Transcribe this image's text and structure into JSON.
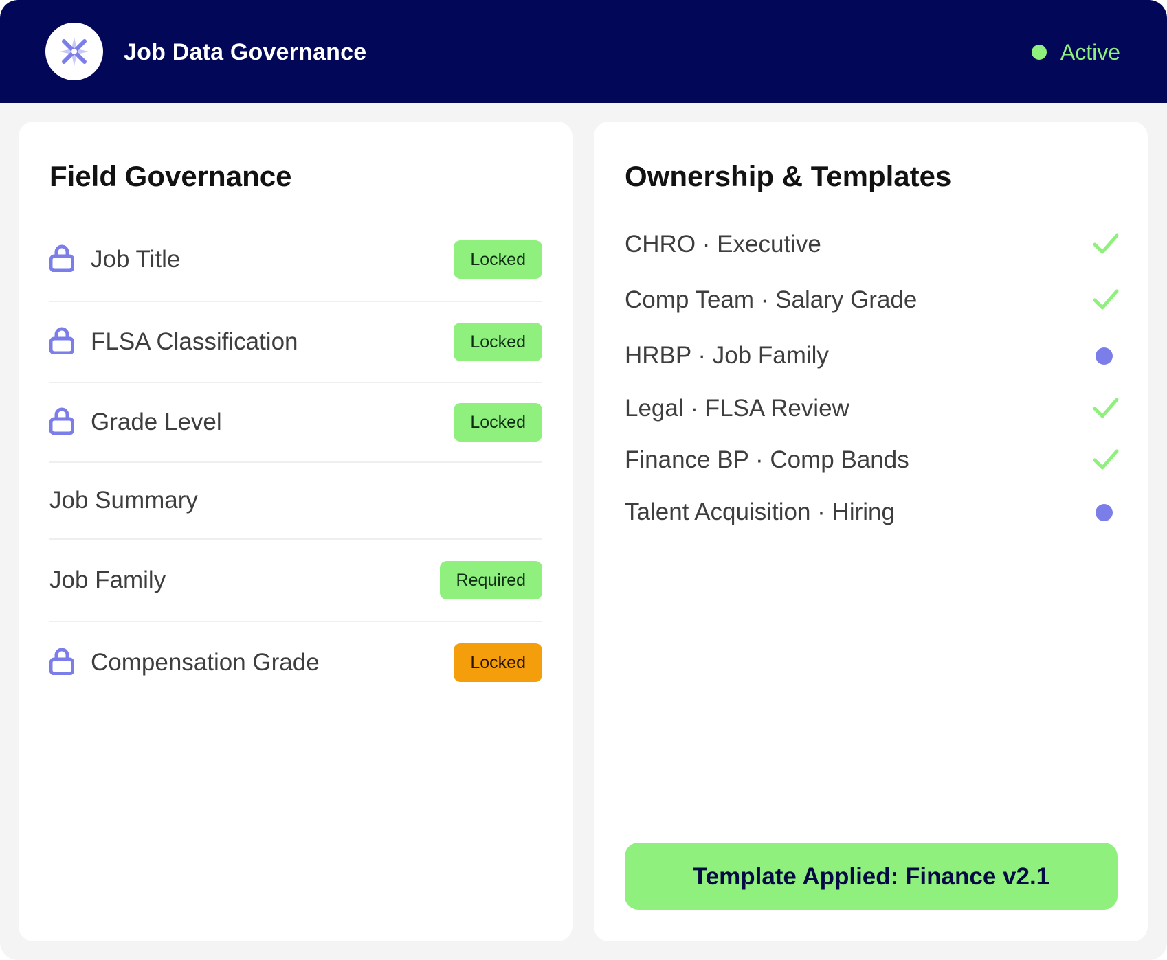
{
  "header": {
    "logo_icon": "star-x-logo-icon",
    "title": "Job Data Governance",
    "status_label": "Active",
    "status_color": "#8ff07e"
  },
  "field_governance": {
    "title": "Field Governance",
    "fields": [
      {
        "label": "Job Title",
        "locked_icon": true,
        "badge": "Locked",
        "badge_color": "#8ff07e"
      },
      {
        "label": "FLSA Classification",
        "locked_icon": true,
        "badge": "Locked",
        "badge_color": "#8ff07e"
      },
      {
        "label": "Grade Level",
        "locked_icon": true,
        "badge": "Locked",
        "badge_color": "#8ff07e"
      },
      {
        "label": "Job Summary",
        "locked_icon": false,
        "badge": ""
      },
      {
        "label": "Job Family",
        "locked_icon": false,
        "badge": "Required",
        "badge_color": "#8ff07e"
      },
      {
        "label": "Compensation Grade",
        "locked_icon": true,
        "badge": "Locked",
        "badge_color": "#f59e0b"
      }
    ]
  },
  "ownership": {
    "title": "Ownership & Templates",
    "items": [
      {
        "label": "CHRO · Executive",
        "status": "check-icon"
      },
      {
        "label": "Comp Team · Salary Grade",
        "status": "check-icon"
      },
      {
        "label": "HRBP · Job Family",
        "status": "pending-dot-icon"
      },
      {
        "label": "Legal · FLSA Review",
        "status": "check-icon"
      },
      {
        "label": "Finance BP · Comp Bands",
        "status": "check-icon"
      },
      {
        "label": "Talent Acquisition · Hiring",
        "status": "pending-dot-icon"
      }
    ],
    "apply_button_label": "Template Applied: Finance v2.1"
  },
  "colors": {
    "header_bg": "#020757",
    "accent_green": "#8ff07e",
    "accent_orange": "#f59e0b",
    "accent_purple": "#7b7ee8"
  }
}
